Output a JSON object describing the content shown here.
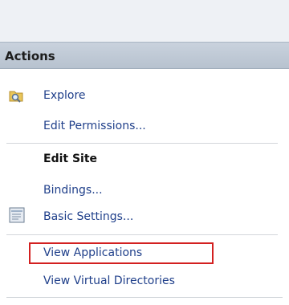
{
  "panel": {
    "title": "Actions"
  },
  "actions_top": {
    "explore": "Explore",
    "edit_permissions": "Edit Permissions..."
  },
  "edit_site": {
    "title": "Edit Site",
    "bindings": "Bindings...",
    "basic_settings": "Basic Settings..."
  },
  "applications": {
    "view_applications": "View Applications",
    "view_virtual_directories": "View Virtual Directories"
  },
  "colors": {
    "header_bg": "#c1cad6",
    "link": "#1f3f8a",
    "highlight": "#d32020"
  },
  "icons": {
    "explore": "folder-search-icon",
    "basic_settings": "settings-document-icon"
  }
}
